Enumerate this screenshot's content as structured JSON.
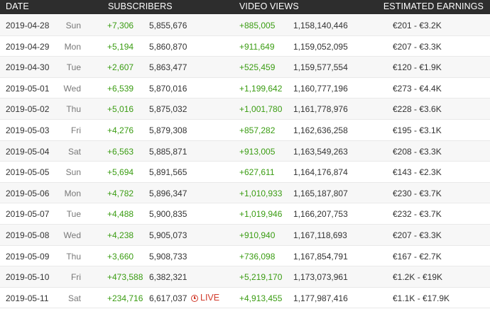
{
  "header": {
    "date": "DATE",
    "subscribers": "SUBSCRIBERS",
    "video_views": "VIDEO VIEWS",
    "estimated_earnings": "ESTIMATED EARNINGS"
  },
  "live_label": "LIVE",
  "colors": {
    "positive": "#3a9c12",
    "live": "#d13b2c",
    "header_bg": "#2d2d2d"
  },
  "rows": [
    {
      "date": "2019-04-28",
      "day": "Sun",
      "subs_delta": "+7,306",
      "subs_total": "5,855,676",
      "views_delta": "+885,005",
      "views_total": "1,158,140,446",
      "earnings": "€201  -  €3.2K"
    },
    {
      "date": "2019-04-29",
      "day": "Mon",
      "subs_delta": "+5,194",
      "subs_total": "5,860,870",
      "views_delta": "+911,649",
      "views_total": "1,159,052,095",
      "earnings": "€207  -  €3.3K"
    },
    {
      "date": "2019-04-30",
      "day": "Tue",
      "subs_delta": "+2,607",
      "subs_total": "5,863,477",
      "views_delta": "+525,459",
      "views_total": "1,159,577,554",
      "earnings": "€120  -  €1.9K"
    },
    {
      "date": "2019-05-01",
      "day": "Wed",
      "subs_delta": "+6,539",
      "subs_total": "5,870,016",
      "views_delta": "+1,199,642",
      "views_total": "1,160,777,196",
      "earnings": "€273  -  €4.4K"
    },
    {
      "date": "2019-05-02",
      "day": "Thu",
      "subs_delta": "+5,016",
      "subs_total": "5,875,032",
      "views_delta": "+1,001,780",
      "views_total": "1,161,778,976",
      "earnings": "€228  -  €3.6K"
    },
    {
      "date": "2019-05-03",
      "day": "Fri",
      "subs_delta": "+4,276",
      "subs_total": "5,879,308",
      "views_delta": "+857,282",
      "views_total": "1,162,636,258",
      "earnings": "€195  -  €3.1K"
    },
    {
      "date": "2019-05-04",
      "day": "Sat",
      "subs_delta": "+6,563",
      "subs_total": "5,885,871",
      "views_delta": "+913,005",
      "views_total": "1,163,549,263",
      "earnings": "€208  -  €3.3K"
    },
    {
      "date": "2019-05-05",
      "day": "Sun",
      "subs_delta": "+5,694",
      "subs_total": "5,891,565",
      "views_delta": "+627,611",
      "views_total": "1,164,176,874",
      "earnings": "€143  -  €2.3K"
    },
    {
      "date": "2019-05-06",
      "day": "Mon",
      "subs_delta": "+4,782",
      "subs_total": "5,896,347",
      "views_delta": "+1,010,933",
      "views_total": "1,165,187,807",
      "earnings": "€230  -  €3.7K"
    },
    {
      "date": "2019-05-07",
      "day": "Tue",
      "subs_delta": "+4,488",
      "subs_total": "5,900,835",
      "views_delta": "+1,019,946",
      "views_total": "1,166,207,753",
      "earnings": "€232  -  €3.7K"
    },
    {
      "date": "2019-05-08",
      "day": "Wed",
      "subs_delta": "+4,238",
      "subs_total": "5,905,073",
      "views_delta": "+910,940",
      "views_total": "1,167,118,693",
      "earnings": "€207  -  €3.3K"
    },
    {
      "date": "2019-05-09",
      "day": "Thu",
      "subs_delta": "+3,660",
      "subs_total": "5,908,733",
      "views_delta": "+736,098",
      "views_total": "1,167,854,791",
      "earnings": "€167  -  €2.7K"
    },
    {
      "date": "2019-05-10",
      "day": "Fri",
      "subs_delta": "+473,588",
      "subs_total": "6,382,321",
      "views_delta": "+5,219,170",
      "views_total": "1,173,073,961",
      "earnings": "€1.2K  -  €19K"
    },
    {
      "date": "2019-05-11",
      "day": "Sat",
      "subs_delta": "+234,716",
      "subs_total": "6,617,037",
      "views_delta": "+4,913,455",
      "views_total": "1,177,987,416",
      "earnings": "€1.1K  -  €17.9K",
      "live": true
    }
  ]
}
